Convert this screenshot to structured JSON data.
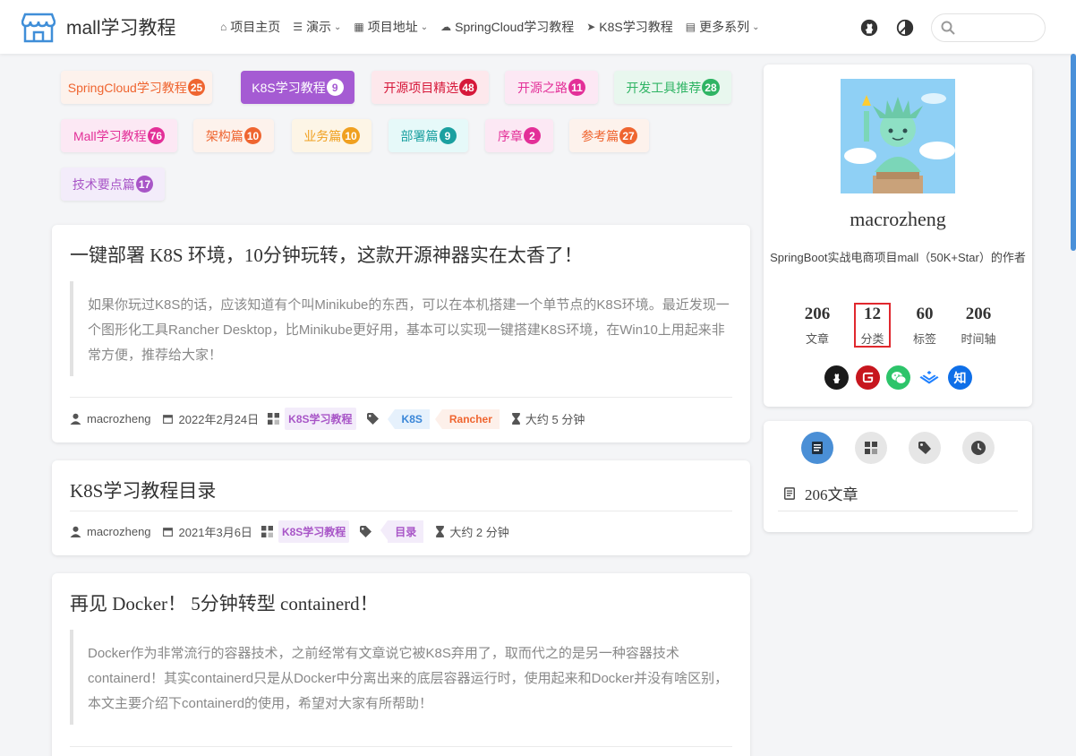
{
  "site": {
    "title": "mall学习教程"
  },
  "nav": {
    "items": [
      {
        "label": "项目主页",
        "icon": "home-icon",
        "caret": false
      },
      {
        "label": "演示",
        "icon": "layers-icon",
        "caret": true
      },
      {
        "label": "项目地址",
        "icon": "grid-icon",
        "caret": true
      },
      {
        "label": "SpringCloud学习教程",
        "icon": "cloud-icon",
        "caret": false
      },
      {
        "label": "K8S学习教程",
        "icon": "rocket-icon",
        "caret": false
      },
      {
        "label": "更多系列",
        "icon": "book-icon",
        "caret": true
      }
    ],
    "search_placeholder": ""
  },
  "categories": [
    {
      "label": "SpringCloud学习教程",
      "count": "25"
    },
    {
      "label": "K8S学习教程",
      "count": "9"
    },
    {
      "label": "开源项目精选",
      "count": "48"
    },
    {
      "label": "开源之路",
      "count": "11"
    },
    {
      "label": "开发工具推荐",
      "count": "28"
    },
    {
      "label": "Mall学习教程",
      "count": "76"
    },
    {
      "label": "架构篇",
      "count": "10"
    },
    {
      "label": "业务篇",
      "count": "10"
    },
    {
      "label": "部署篇",
      "count": "9"
    },
    {
      "label": "序章",
      "count": "2"
    },
    {
      "label": "参考篇",
      "count": "27"
    },
    {
      "label": "技术要点篇",
      "count": "17"
    }
  ],
  "posts": [
    {
      "title": "一键部署 K8S 环境，10分钟玩转，这款开源神器实在太香了！",
      "excerpt": "如果你玩过K8S的话，应该知道有个叫Minikube的东西，可以在本机搭建一个单节点的K8S环境。最近发现一个图形化工具Rancher Desktop，比Minikube更好用，基本可以实现一键搭建K8S环境，在Win10上用起来非常方便，推荐给大家！",
      "author": "macrozheng",
      "date": "2022年2月24日",
      "category": "K8S学习教程",
      "tags": [
        "K8S",
        "Rancher"
      ],
      "read_time": "大约 5 分钟"
    },
    {
      "title": "K8S学习教程目录",
      "author": "macrozheng",
      "date": "2021年3月6日",
      "category": "K8S学习教程",
      "tags": [
        "目录"
      ],
      "read_time": "大约 2 分钟"
    },
    {
      "title": "再见 Docker！ 5分钟转型 containerd！",
      "excerpt": "Docker作为非常流行的容器技术，之前经常有文章说它被K8S弃用了，取而代之的是另一种容器技术containerd！其实containerd只是从Docker中分离出来的底层容器运行时，使用起来和Docker并没有啥区别，本文主要介绍下containerd的使用，希望对大家有所帮助！"
    }
  ],
  "profile": {
    "name": "macrozheng",
    "description": "SpringBoot实战电商项目mall（50K+Star）的作者",
    "stats": [
      {
        "num": "206",
        "label": "文章"
      },
      {
        "num": "12",
        "label": "分类"
      },
      {
        "num": "60",
        "label": "标签"
      },
      {
        "num": "206",
        "label": "时间轴"
      }
    ],
    "socials": [
      "github-icon",
      "gitee-icon",
      "wechat-icon",
      "juejin-icon",
      "zhihu-icon"
    ],
    "zhihu_glyph": "知"
  },
  "blog_nav": {
    "count_text": "206文章"
  },
  "colors": {
    "accent": "#4a8fd6",
    "highlight": "#e0282e"
  }
}
